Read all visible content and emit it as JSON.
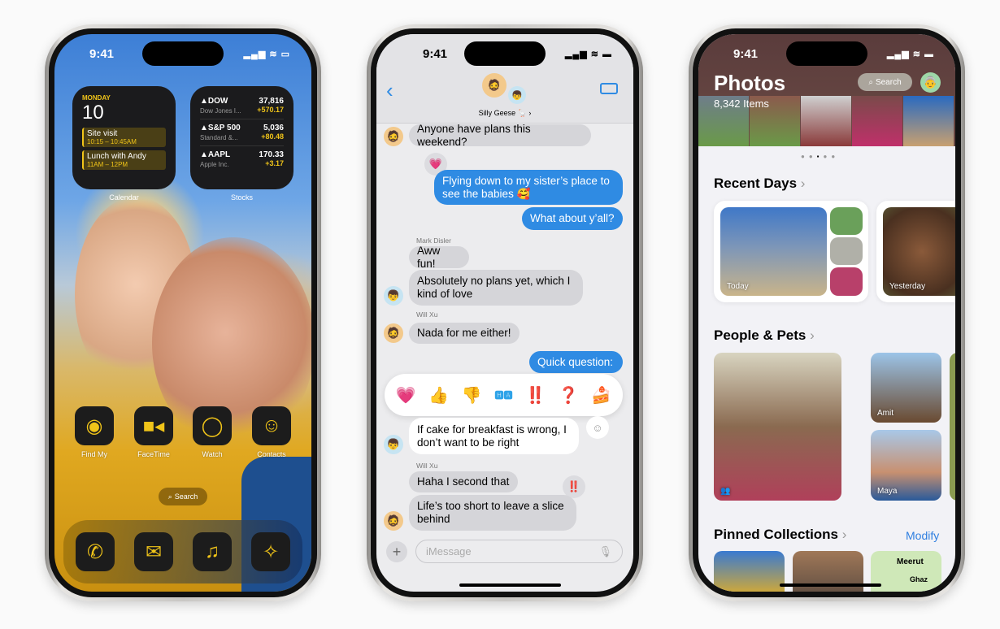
{
  "status": {
    "time": "9:41",
    "icons": "signal-wifi-battery"
  },
  "home": {
    "calendar": {
      "day": "MONDAY",
      "date": "10",
      "events": [
        {
          "title": "Site visit",
          "time": "10:15 – 10:45AM"
        },
        {
          "title": "Lunch with Andy",
          "time": "11AM – 12PM"
        }
      ],
      "label": "Calendar"
    },
    "stocks": {
      "label": "Stocks",
      "items": [
        {
          "symbol": "▲DOW",
          "name": "Dow Jones I...",
          "price": "37,816",
          "change": "+570.17"
        },
        {
          "symbol": "▲S&P 500",
          "name": "Standard &...",
          "price": "5,036",
          "change": "+80.48"
        },
        {
          "symbol": "▲AAPL",
          "name": "Apple Inc.",
          "price": "170.33",
          "change": "+3.17"
        }
      ]
    },
    "apps": [
      {
        "label": "Find My",
        "icon": "find-my-icon"
      },
      {
        "label": "FaceTime",
        "icon": "facetime-icon"
      },
      {
        "label": "Watch",
        "icon": "watch-icon"
      },
      {
        "label": "Contacts",
        "icon": "contacts-icon"
      }
    ],
    "search": "Search",
    "dock": [
      "phone-icon",
      "mail-icon",
      "music-icon",
      "safari-icon"
    ],
    "accent": "#f0c419"
  },
  "messages": {
    "group": "Silly Geese 🪿 ›",
    "thread": [
      {
        "text": "Anyone have plans this weekend?"
      },
      {
        "tapback": "💗"
      },
      {
        "text": "Flying down to my sister’s place to see the babies 🥰"
      },
      {
        "text": "What about y’all?"
      },
      {
        "sender": "Mark Disler"
      },
      {
        "text": "Aww fun!"
      },
      {
        "text": "Absolutely no plans yet, which I kind of love"
      },
      {
        "sender": "Will Xu"
      },
      {
        "text": "Nada for me either!"
      },
      {
        "text": "Quick question:"
      },
      {
        "text": "If cake for breakfast is wrong, I don’t want to be right"
      },
      {
        "sender": "Will Xu"
      },
      {
        "text": "Haha I second that"
      },
      {
        "tapback": "‼️"
      },
      {
        "text": "Life’s too short to leave a slice behind"
      }
    ],
    "reactions": [
      "💗",
      "👍",
      "👎",
      "🅷🅰",
      "‼️",
      "❓",
      "🍰"
    ],
    "input_placeholder": "iMessage",
    "bubble_color": "#2f8be3"
  },
  "photos": {
    "title": "Photos",
    "count": "8,342 Items",
    "search": "Search",
    "recent_days": "Recent Days",
    "cards": [
      "Today",
      "Yesterday"
    ],
    "people_pets": "People & Pets",
    "people": [
      "Amit",
      "Maya"
    ],
    "pinned": "Pinned Collections",
    "modify": "Modify",
    "map_labels": [
      "Meerut",
      "Ghaz"
    ],
    "link_color": "#2f7fe0"
  }
}
